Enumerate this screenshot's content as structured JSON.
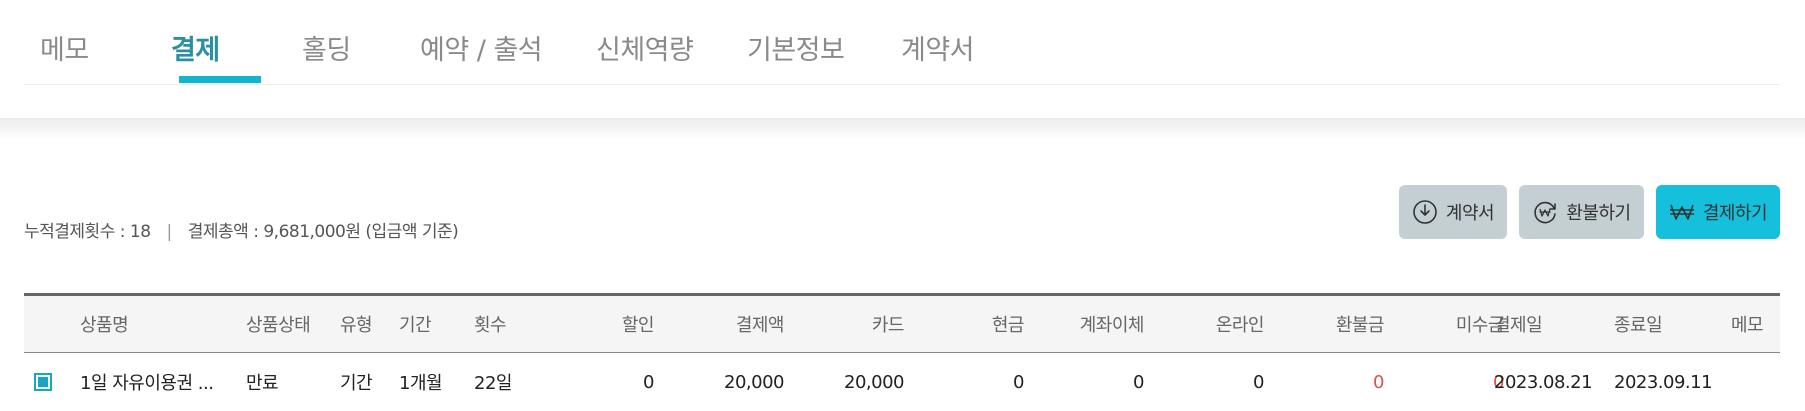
{
  "tabs": [
    {
      "label": "메모"
    },
    {
      "label": "결제"
    },
    {
      "label": "홀딩"
    },
    {
      "label": "예약 / 출석"
    },
    {
      "label": "신체역량"
    },
    {
      "label": "기본정보"
    },
    {
      "label": "계약서"
    }
  ],
  "active_tab": "결제",
  "summary": {
    "count_text": "누적결제횟수 : 18",
    "separator": "|",
    "total_text": "결제총액 : 9,681,000원 (입금액 기준)"
  },
  "buttons": {
    "contract": "계약서",
    "refund": "환불하기",
    "pay": "결제하기"
  },
  "icons": {
    "contract": "download-circle-icon",
    "refund": "refund-circle-icon",
    "pay": "won-icon"
  },
  "colors": {
    "accent": "#14c0dc",
    "active_tab_text": "#2a8fa0",
    "refund_amount": "#d9534f",
    "gray_button": "#c3cfd3"
  },
  "table": {
    "headers": {
      "product": "상품명",
      "status": "상품상태",
      "type": "유형",
      "period": "기간",
      "count": "횟수",
      "discount": "할인",
      "amount": "결제액",
      "card": "카드",
      "cash": "현금",
      "transfer": "계좌이체",
      "online": "온라인",
      "refund": "환불금",
      "unpaid": "미수금",
      "pay_date": "결제일",
      "end_date": "종료일",
      "memo": "메모"
    },
    "rows": [
      {
        "checked": true,
        "product": "1일 자유이용권 ...",
        "status": "만료",
        "type": "기간",
        "period": "1개월",
        "count": "22일",
        "discount": "0",
        "amount": "20,000",
        "card": "20,000",
        "cash": "0",
        "transfer": "0",
        "online": "0",
        "refund": "0",
        "unpaid": "0",
        "pay_date": "2023.08.21",
        "end_date": "2023.09.11",
        "memo": ""
      }
    ]
  }
}
